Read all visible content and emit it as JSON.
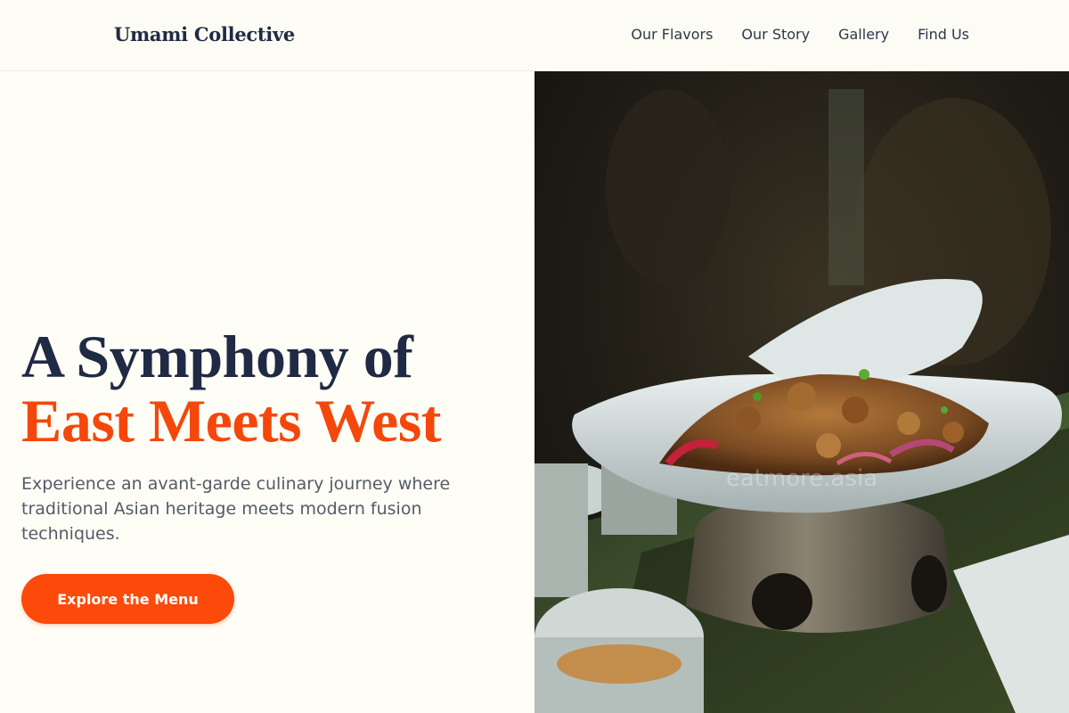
{
  "header": {
    "brand": "Umami Collective",
    "nav": [
      "Our Flavors",
      "Our Story",
      "Gallery",
      "Find Us"
    ]
  },
  "hero": {
    "headline_line1": "A Symphony of",
    "headline_line2": "East Meets West",
    "description": "Experience an avant-garde culinary journey where traditional Asian heritage meets modern fusion techniques.",
    "cta_label": "Explore the Menu",
    "image_alt": "Stir-fried dish served in a white bowl on a metal warmer stand",
    "watermark": "eatmore.asia"
  },
  "colors": {
    "accent": "#fb4a0a",
    "headline_dark": "#1f2a44",
    "background": "#fefdf6"
  }
}
